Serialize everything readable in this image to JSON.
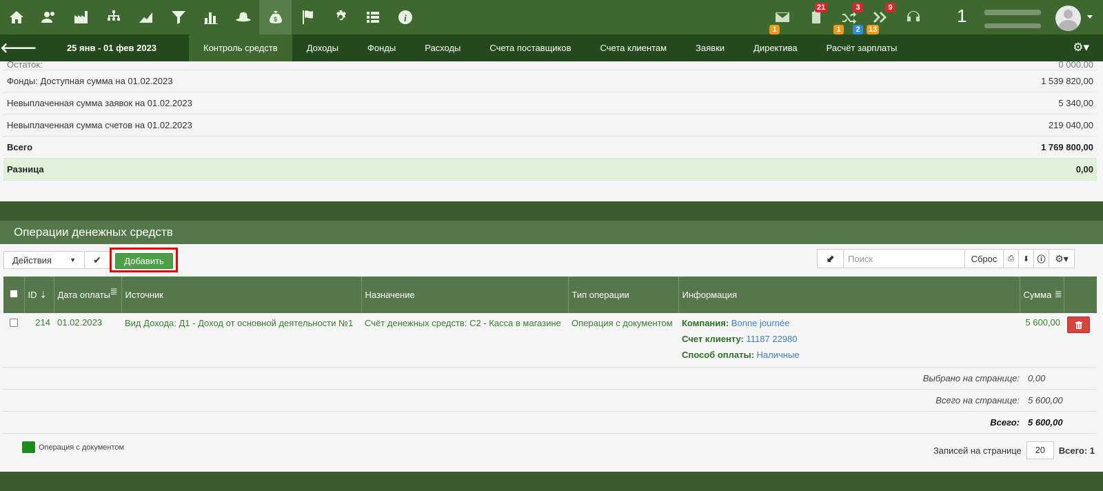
{
  "topbar": {
    "icons": [
      "home-icon",
      "users-icon",
      "factory-icon",
      "org-chart-icon",
      "area-chart-icon",
      "filter-icon",
      "bar-chart-icon",
      "hat-icon",
      "money-bag-icon",
      "flag-icon",
      "gear-icon",
      "list-icon",
      "info-icon"
    ],
    "active_icon": "money-bag-icon",
    "notifications": {
      "mail_count": "1",
      "tasks_count": "21",
      "shuffle_top": "3",
      "shuffle_orange": "1",
      "shuffle_blue": "2",
      "forward_top": "9",
      "forward_orange": "13"
    },
    "user_number": "1"
  },
  "subnav": {
    "back_label": "🡐",
    "period": "25 янв - 01 фев 2023",
    "tabs": [
      "Контроль средств",
      "Доходы",
      "Фонды",
      "Расходы",
      "Счета поставщиков",
      "Счета клиентам",
      "Заявки",
      "Директива",
      "Расчёт зарплаты"
    ],
    "active_tab": "Контроль средств"
  },
  "summary": {
    "cut_row": {
      "label": "Остаток:",
      "value": "0 000,00"
    },
    "rows": [
      {
        "label": "Фонды: Доступная сумма на 01.02.2023",
        "value": "1 539 820,00"
      },
      {
        "label": "Невыплаченная сумма заявок на 01.02.2023",
        "value": "5 340,00"
      },
      {
        "label": "Невыплаченная сумма счетов на 01.02.2023",
        "value": "219 040,00"
      }
    ],
    "total": {
      "label": "Всего",
      "value": "1 769 800,00"
    },
    "difference": {
      "label": "Разница",
      "value": "0,00"
    }
  },
  "operations": {
    "title": "Операции денежных средств",
    "actions_label": "Действия",
    "add_label": "Добавить",
    "search_placeholder": "Поиск",
    "reset_label": "Сброс",
    "columns": {
      "id": "ID",
      "date": "Дата оплаты",
      "source": "Источник",
      "purpose": "Назначение",
      "type": "Тип операции",
      "info": "Информация",
      "sum": "Сумма"
    },
    "row": {
      "id": "214",
      "date": "01.02.2023",
      "source": "Вид Дохода: Д1 - Доход от основной деятельности №1",
      "purpose": "Счёт денежных средств: С2 - Касса в магазине",
      "type": "Операция с документом",
      "company_label": "Компания:",
      "company": "Bonne journée",
      "invoice_label": "Счет клиенту:",
      "invoice": "11187 22980",
      "payment_label": "Способ оплаты:",
      "payment": "Наличные",
      "sum": "5 600,00"
    },
    "totals": [
      {
        "label": "Выбрано на странице:",
        "value": "0,00"
      },
      {
        "label": "Всего на странице:",
        "value": "5 600,00"
      },
      {
        "label": "Всего:",
        "value": "5 600,00"
      }
    ],
    "legend": "Операция с документом",
    "per_page_label": "Записей на странице",
    "per_page": "20",
    "total_records": "Всего: 1"
  },
  "colors": {
    "topbar": "#3f6830",
    "subnav": "#24491a",
    "header": "#54784a",
    "add_button": "#4da048",
    "highlight": "#ee0000"
  }
}
